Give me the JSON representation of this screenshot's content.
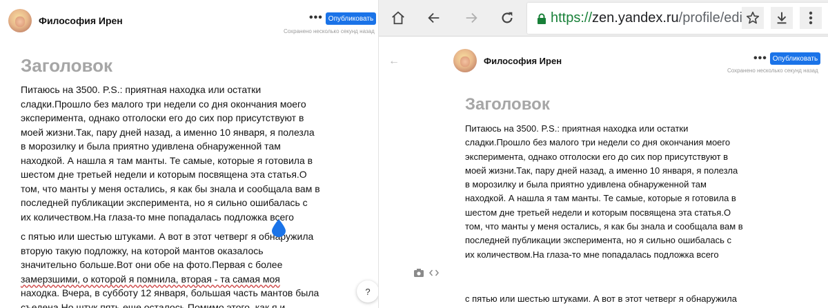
{
  "editor": {
    "author": "Философия Ирен",
    "publish_label": "Опубликовать",
    "more_label": "•••",
    "saved_status": "Сохранено несколько секунд назад",
    "title_placeholder": "Заголовок",
    "help_label": "?",
    "paragraph1": [
      "Питаюсь на 3500. P.S.: приятная находка или остатки",
      "сладки.Прошло без малого три недели со дня окончания моего",
      "эксперимента, однако отголоски его до сих пор присутствуют в",
      "моей жизни.Так, пару дней назад, а именно 10 января, я полезла",
      "в морозилку и была приятно удивлена обнаруженной там",
      "находкой. А нашла я там манты. Те самые, которые я готовила в",
      "шестом дне третьей недели и  которым посвящена эта статья.О",
      "том, что манты у меня остались, я как бы знала и сообщала вам в",
      " последней публикации эксперимента, но я сильно ошибалась с",
      "их количеством.На глаза-то мне попадалась подложка всего"
    ],
    "paragraph2": [
      "с пятью или шестью штуками. А вот в этот четверг я обнаружила",
      "вторую такую подложку, на которой мантов оказалось",
      "значительно больше.Вот они обе на фото.Первая с более",
      "замерзшими, о которой я помнила, вторая - та самая моя",
      "находка. Вчера, в субботу 12 января, большая часть мантов была",
      "съедена.Но штук пять еще осталось.Помимо этого, как я и"
    ]
  },
  "browser": {
    "url_scheme": "https://",
    "url_host": "zen.yandex.ru",
    "url_path": "/profile/edito",
    "icons": [
      "home-icon",
      "back-icon",
      "forward-icon",
      "reload-icon",
      "lock-icon",
      "star-icon",
      "download-icon",
      "menu-icon"
    ]
  },
  "colors": {
    "accent": "#1a73e8",
    "secure": "#188038",
    "title_placeholder": "#a6a6a6"
  }
}
